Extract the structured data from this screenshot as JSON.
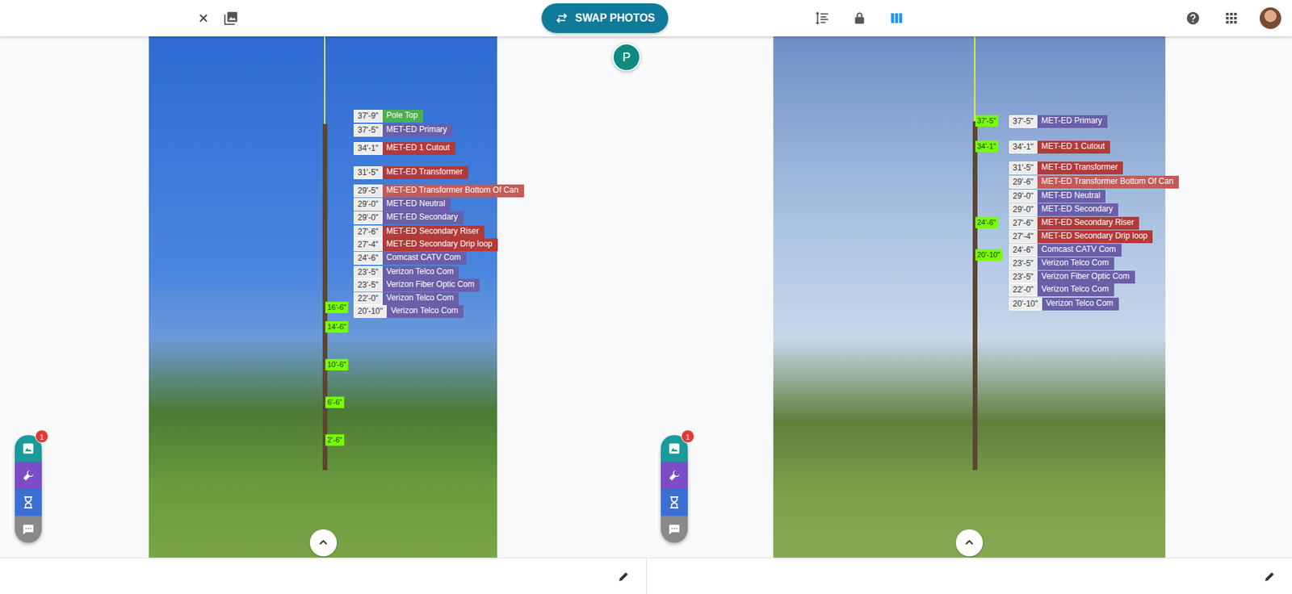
{
  "header": {
    "swap_button": "SWAP PHOTOS",
    "columns_view": {
      "selected": true
    }
  },
  "user_marker": "P",
  "photos": [
    {
      "side": "left",
      "badge": "1",
      "labels": [
        {
          "height": "37'-9\"",
          "name": "Pole Top",
          "color": "#4caf50"
        },
        {
          "height": "37'-5\"",
          "name": "MET-ED Primary",
          "color": "#6a5fa8"
        },
        {
          "height": "34'-1\"",
          "name": "MET-ED 1 Cutout",
          "color": "#b23a3a"
        },
        {
          "height": "31'-5\"",
          "name": "MET-ED Transformer",
          "color": "#b23a3a"
        },
        {
          "height": "29'-5\"",
          "name": "MET-ED Transformer Bottom Of Can",
          "color": "#c45a58"
        },
        {
          "height": "29'-0\"",
          "name": "MET-ED Neutral",
          "color": "#6a5fa8"
        },
        {
          "height": "29'-0\"",
          "name": "MET-ED Secondary",
          "color": "#6a5fa8"
        },
        {
          "height": "27'-6\"",
          "name": "MET-ED Secondary Riser",
          "color": "#b23a3a"
        },
        {
          "height": "27'-4\"",
          "name": "MET-ED Secondary Drip loop",
          "color": "#b23a3a"
        },
        {
          "height": "24'-6\"",
          "name": "Comcast CATV Com",
          "color": "#6a5fa8"
        },
        {
          "height": "23'-5\"",
          "name": "Verizon Telco Com",
          "color": "#6a5fa8"
        },
        {
          "height": "23'-5\"",
          "name": "Verizon Fiber Optic Com",
          "color": "#6a5fa8"
        },
        {
          "height": "22'-0\"",
          "name": "Verizon Telco Com",
          "color": "#6a5fa8"
        },
        {
          "height": "20'-10\"",
          "name": "Verizon Telco Com",
          "color": "#6a5fa8"
        }
      ],
      "ruler_marks": [
        "16'-6\"",
        "14'-6\"",
        "10'-6\"",
        "6'-6\"",
        "2'-6\""
      ]
    },
    {
      "side": "right",
      "badge": "1",
      "labels": [
        {
          "height": "37'-5\"",
          "name": "MET-ED Primary",
          "color": "#6a5fa8"
        },
        {
          "height": "34'-1\"",
          "name": "MET-ED 1 Cutout",
          "color": "#b23a3a"
        },
        {
          "height": "31'-5\"",
          "name": "MET-ED Transformer",
          "color": "#b23a3a"
        },
        {
          "height": "29'-6\"",
          "name": "MET-ED Transformer Bottom Of Can",
          "color": "#c45a58"
        },
        {
          "height": "29'-0\"",
          "name": "MET-ED Neutral",
          "color": "#6a5fa8"
        },
        {
          "height": "29'-0\"",
          "name": "MET-ED Secondary",
          "color": "#6a5fa8"
        },
        {
          "height": "27'-6\"",
          "name": "MET-ED Secondary Riser",
          "color": "#b23a3a"
        },
        {
          "height": "27'-4\"",
          "name": "MET-ED Secondary Drip loop",
          "color": "#b23a3a"
        },
        {
          "height": "24'-6\"",
          "name": "Comcast CATV Com",
          "color": "#6a5fa8"
        },
        {
          "height": "23'-5\"",
          "name": "Verizon Telco Com",
          "color": "#6a5fa8"
        },
        {
          "height": "23'-5\"",
          "name": "Verizon Fiber Optic Com",
          "color": "#6a5fa8"
        },
        {
          "height": "22'-0\"",
          "name": "Verizon Telco Com",
          "color": "#6a5fa8"
        },
        {
          "height": "20'-10\"",
          "name": "Verizon Telco Com",
          "color": "#6a5fa8"
        }
      ],
      "ruler_marks": [
        "37'-5\"",
        "34'-1\"",
        "24'-6\"",
        "20'-10\""
      ]
    }
  ]
}
